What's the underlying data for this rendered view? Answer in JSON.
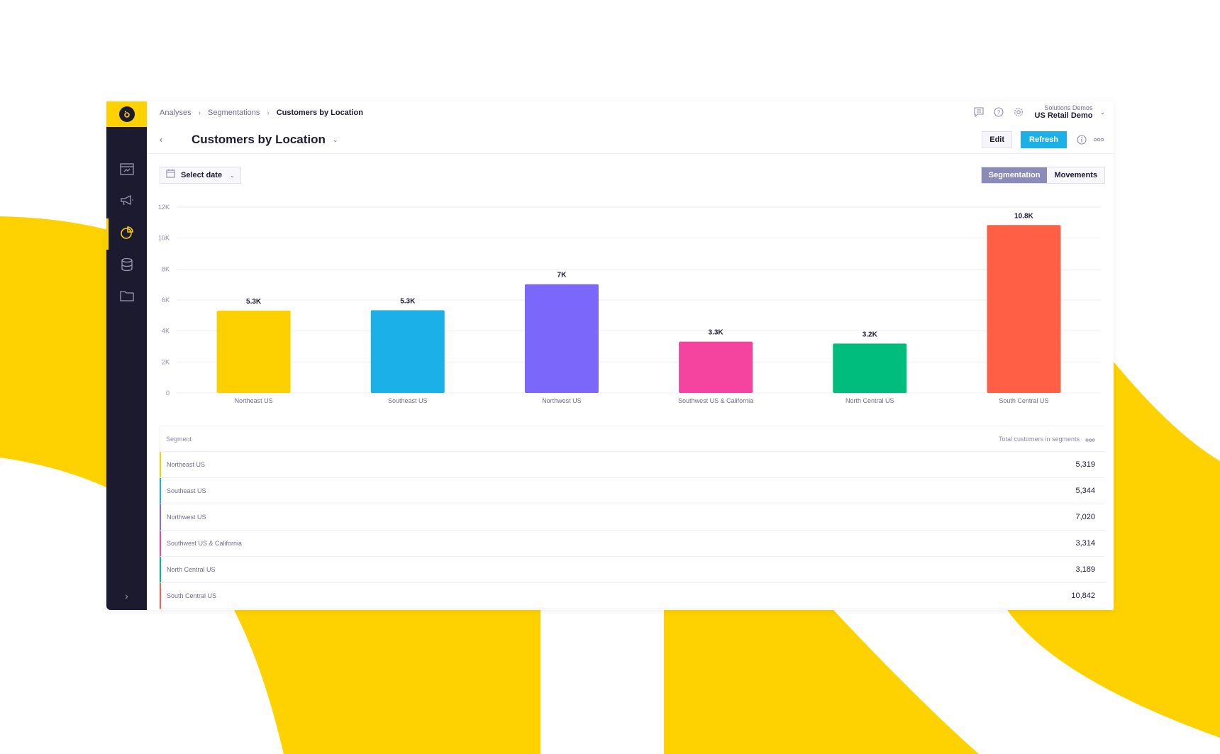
{
  "breadcrumb": {
    "items": [
      "Analyses",
      "Segmentations"
    ],
    "current": "Customers by Location"
  },
  "header": {
    "title": "Customers by Location",
    "account_org": "Solutions Demos",
    "account_project": "US Retail Demo",
    "edit_label": "Edit",
    "refresh_label": "Refresh"
  },
  "icons": {
    "sidebar": [
      "dashboard-icon",
      "megaphone-icon",
      "pie-chart-icon",
      "database-icon",
      "folder-icon"
    ],
    "top": [
      "comment-icon",
      "help-icon",
      "gear-icon",
      "info-icon",
      "more-icon",
      "calendar-icon"
    ]
  },
  "filters": {
    "date_label": "Select date"
  },
  "view_toggle": {
    "options": [
      "Segmentation",
      "Movements"
    ],
    "active": "Segmentation"
  },
  "colors": {
    "brand_yellow": "#fdd200",
    "sidebar_bg": "#1c1a2e",
    "refresh_blue": "#1bb1e8",
    "toggle_active": "#8a8bb8"
  },
  "chart_data": {
    "type": "bar",
    "title": "",
    "xlabel": "",
    "ylabel": "",
    "categories": [
      "Northeast US",
      "Southeast US",
      "Northwest US",
      "Southwest US & California",
      "North Central US",
      "South Central US"
    ],
    "values": [
      5319,
      5344,
      7020,
      3314,
      3189,
      10842
    ],
    "data_labels": [
      "5.3K",
      "5.3K",
      "7K",
      "3.3K",
      "3.2K",
      "10.8K"
    ],
    "colors": [
      "#fdd000",
      "#1bb1e8",
      "#7b68fb",
      "#f544a0",
      "#00bd7e",
      "#ff5f45"
    ],
    "ylim": [
      0,
      12000
    ],
    "yticks": [
      0,
      2000,
      4000,
      6000,
      8000,
      10000,
      12000
    ],
    "ytick_labels": [
      "0",
      "2K",
      "4K",
      "6K",
      "8K",
      "10K",
      "12K"
    ],
    "grid": true,
    "legend": "none"
  },
  "table": {
    "columns": [
      "Segment",
      "Total customers in segments"
    ],
    "rows": [
      {
        "segment": "Northeast US",
        "value": "5,319",
        "color": "#fdd000"
      },
      {
        "segment": "Southeast US",
        "value": "5,344",
        "color": "#1bb1e8"
      },
      {
        "segment": "Northwest US",
        "value": "7,020",
        "color": "#7b68fb"
      },
      {
        "segment": "Southwest US & California",
        "value": "3,314",
        "color": "#f544a0"
      },
      {
        "segment": "North Central US",
        "value": "3,189",
        "color": "#00bd7e"
      },
      {
        "segment": "South Central US",
        "value": "10,842",
        "color": "#ff5f45"
      }
    ]
  }
}
